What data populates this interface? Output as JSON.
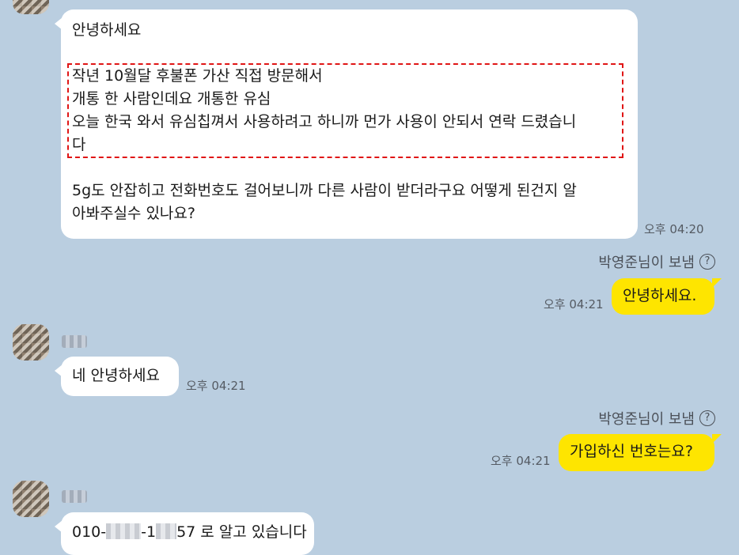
{
  "messages": {
    "m1": {
      "lines": [
        "안녕하세요",
        "",
        "작년 10월달 후불폰 가산 직접 방문해서",
        "개통 한 사람인데요 개통한 유심",
        "오늘 한국 와서 유심칩껴서 사용하려고 하니까 먼가 사용이 안되서 연락 드렸습니",
        "다",
        "",
        "5g도 안잡히고 전화번호도 걸어보니까 다른 사람이 받더라구요 어떻게 된건지 알",
        "아봐주실수 있나요?"
      ],
      "time": "오후 04:20"
    },
    "s1": {
      "sender": "박영준님이 보냄",
      "help": "?"
    },
    "m2": {
      "text": "안녕하세요.",
      "time": "오후 04:21"
    },
    "m3": {
      "text": "네 안녕하세요",
      "time": "오후 04:21"
    },
    "s2": {
      "sender": "박영준님이 보냄",
      "help": "?"
    },
    "m4": {
      "text": "가입하신 번호는요?",
      "time": "오후 04:21"
    },
    "m5": {
      "prefix": "010-",
      "mid": "-1",
      "suffix": "57 로 알고 있습니다"
    }
  }
}
